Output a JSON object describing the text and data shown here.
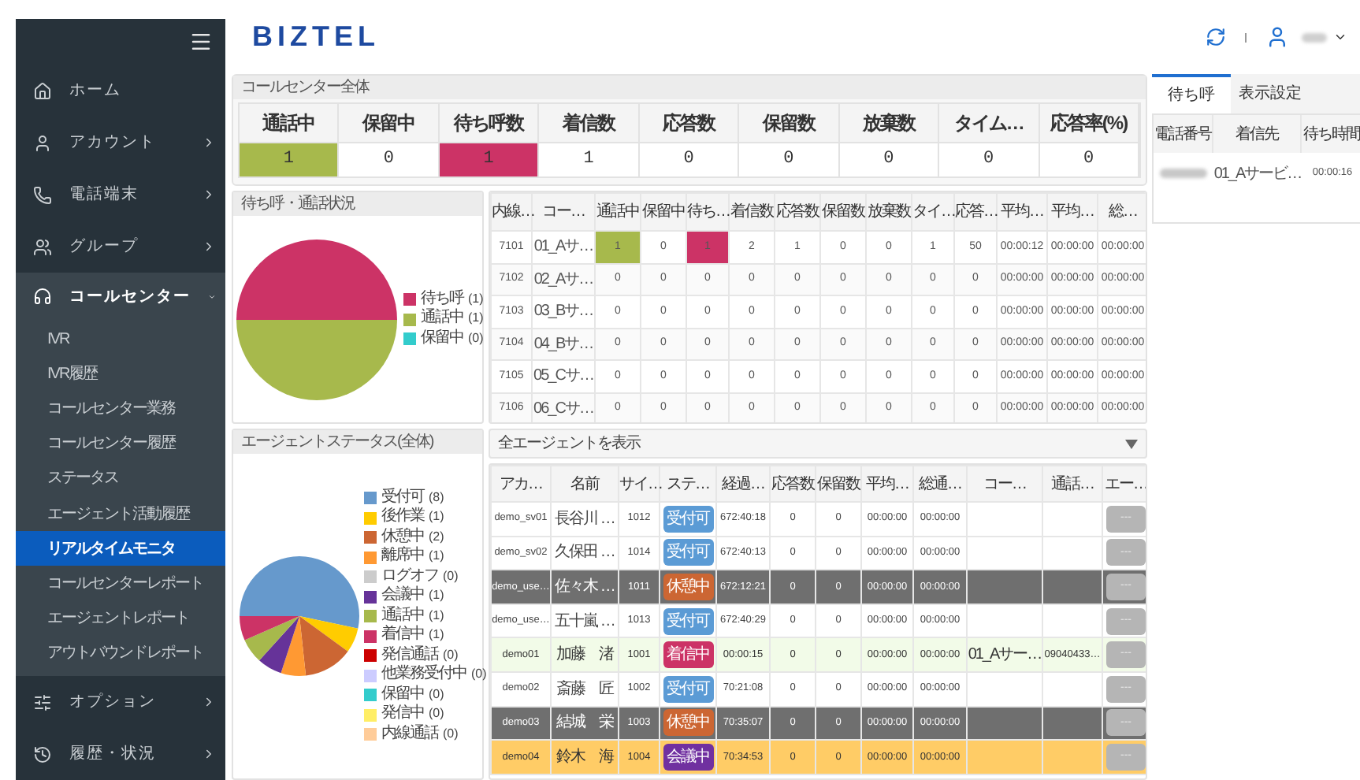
{
  "sidebar": {
    "items": [
      {
        "label": "ホーム",
        "kind": "link"
      },
      {
        "label": "アカウント",
        "kind": "group",
        "expanded": false
      },
      {
        "label": "電話端末",
        "kind": "group",
        "expanded": false
      },
      {
        "label": "グループ",
        "kind": "group",
        "expanded": false
      },
      {
        "label": "コールセンター",
        "kind": "group",
        "expanded": true,
        "children": [
          {
            "label": "IVR",
            "selected": false
          },
          {
            "label": "IVR履歴",
            "selected": false
          },
          {
            "label": "コールセンター業務",
            "selected": false
          },
          {
            "label": "コールセンター履歴",
            "selected": false
          },
          {
            "label": "ステータス",
            "selected": false
          },
          {
            "label": "エージェント活動履歴",
            "selected": false
          },
          {
            "label": "リアルタイムモニタ",
            "selected": true
          },
          {
            "label": "コールセンターレポート",
            "selected": false
          },
          {
            "label": "エージェントレポート",
            "selected": false
          },
          {
            "label": "アウトバウンドレポート",
            "selected": false
          }
        ]
      },
      {
        "label": "オプション",
        "kind": "group",
        "expanded": false
      },
      {
        "label": "履歴・状況",
        "kind": "group",
        "expanded": false
      }
    ]
  },
  "header": {
    "logo": "BIZTEL"
  },
  "summary": {
    "title": "コールセンター全体",
    "columns": [
      {
        "label": "通話中",
        "value": "1",
        "color": "#a7b94c"
      },
      {
        "label": "保留中",
        "value": "0"
      },
      {
        "label": "待ち呼数",
        "value": "1",
        "color": "#cc3366"
      },
      {
        "label": "着信数",
        "value": "1"
      },
      {
        "label": "応答数",
        "value": "0"
      },
      {
        "label": "保留数",
        "value": "0"
      },
      {
        "label": "放棄数",
        "value": "0"
      },
      {
        "label": "タイム…",
        "value": "0"
      },
      {
        "label": "応答率(%)",
        "value": "0"
      }
    ]
  },
  "wait_status": {
    "title": "待ち呼・通話状況",
    "legend": [
      {
        "count": "(1)",
        "color": "#cc3366"
      },
      {
        "count": "(1)",
        "color": "#a7b94c"
      },
      {
        "count": "(0)",
        "color": "#33cccc"
      }
    ],
    "chart_data": {
      "type": "pie",
      "categories": [
        "待ち呼",
        "通話中",
        "保留中"
      ],
      "values": [
        50,
        50,
        0
      ]
    }
  },
  "service_table": {
    "columns": [
      "内線…",
      "コー…",
      "通話中",
      "保留中",
      "待ち…",
      "着信数",
      "応答数",
      "保留数",
      "放棄数",
      "タイ…",
      "応答…",
      "平均…",
      "平均…",
      "総…"
    ],
    "rows": [
      {
        "cells": [
          {
            "text": "7101"
          },
          {
            "text": "01_Aサ…"
          },
          {
            "text": "1",
            "color": "#a7b94c"
          },
          {
            "text": "0"
          },
          {
            "text": "1",
            "color": "#cc3366"
          },
          {
            "text": "2"
          },
          {
            "text": "1"
          },
          {
            "text": "0"
          },
          {
            "text": "0"
          },
          {
            "text": "1"
          },
          {
            "text": "50"
          },
          {
            "text": "00:00:12"
          },
          {
            "text": "00:00:00"
          },
          {
            "text": "00:00:00"
          }
        ]
      },
      {
        "cells": [
          {
            "text": "7102"
          },
          {
            "text": "02_Aサ…"
          },
          {
            "text": "0"
          },
          {
            "text": "0"
          },
          {
            "text": "0"
          },
          {
            "text": "0"
          },
          {
            "text": "0"
          },
          {
            "text": "0"
          },
          {
            "text": "0"
          },
          {
            "text": "0"
          },
          {
            "text": "0"
          },
          {
            "text": "00:00:00"
          },
          {
            "text": "00:00:00"
          },
          {
            "text": "00:00:00"
          }
        ]
      },
      {
        "cells": [
          {
            "text": "7103"
          },
          {
            "text": "03_Bサ…"
          },
          {
            "text": "0"
          },
          {
            "text": "0"
          },
          {
            "text": "0"
          },
          {
            "text": "0"
          },
          {
            "text": "0"
          },
          {
            "text": "0"
          },
          {
            "text": "0"
          },
          {
            "text": "0"
          },
          {
            "text": "0"
          },
          {
            "text": "00:00:00"
          },
          {
            "text": "00:00:00"
          },
          {
            "text": "00:00:00"
          }
        ]
      },
      {
        "cells": [
          {
            "text": "7104"
          },
          {
            "text": "04_Bサ…"
          },
          {
            "text": "0"
          },
          {
            "text": "0"
          },
          {
            "text": "0"
          },
          {
            "text": "0"
          },
          {
            "text": "0"
          },
          {
            "text": "0"
          },
          {
            "text": "0"
          },
          {
            "text": "0"
          },
          {
            "text": "0"
          },
          {
            "text": "00:00:00"
          },
          {
            "text": "00:00:00"
          },
          {
            "text": "00:00:00"
          }
        ]
      },
      {
        "cells": [
          {
            "text": "7105"
          },
          {
            "text": "05_Cサ…"
          },
          {
            "text": "0"
          },
          {
            "text": "0"
          },
          {
            "text": "0"
          },
          {
            "text": "0"
          },
          {
            "text": "0"
          },
          {
            "text": "0"
          },
          {
            "text": "0"
          },
          {
            "text": "0"
          },
          {
            "text": "0"
          },
          {
            "text": "00:00:00"
          },
          {
            "text": "00:00:00"
          },
          {
            "text": "00:00:00"
          }
        ]
      },
      {
        "cells": [
          {
            "text": "7106"
          },
          {
            "text": "06_Cサ…"
          },
          {
            "text": "0"
          },
          {
            "text": "0"
          },
          {
            "text": "0"
          },
          {
            "text": "0"
          },
          {
            "text": "0"
          },
          {
            "text": "0"
          },
          {
            "text": "0"
          },
          {
            "text": "0"
          },
          {
            "text": "0"
          },
          {
            "text": "00:00:00"
          },
          {
            "text": "00:00:00"
          },
          {
            "text": "00:00:00"
          }
        ]
      }
    ]
  },
  "agent_status": {
    "title": "エージェントステータス(全体)",
    "legend": [
      {
        "count": "(8)",
        "color": "#6699cc"
      },
      {
        "count": "(1)",
        "color": "#ffcc00"
      },
      {
        "count": "(2)",
        "color": "#cc6633"
      },
      {
        "count": "(1)",
        "color": "#ff9933"
      },
      {
        "count": "(0)",
        "color": "#cccccc"
      },
      {
        "count": "(1)",
        "color": "#663399"
      },
      {
        "count": "(1)",
        "color": "#a7b94c"
      },
      {
        "count": "(1)",
        "color": "#cc3366"
      },
      {
        "count": "(0)",
        "color": "#cc0000"
      },
      {
        "count": "(0)",
        "color": "#ccccff"
      },
      {
        "count": "(0)",
        "color": "#33cccc"
      },
      {
        "count": "(0)",
        "color": "#ffee66"
      },
      {
        "count": "(0)",
        "color": "#ffcc99"
      }
    ],
    "chart_data": {
      "type": "pie",
      "categories": [
        "受付可",
        "後作業",
        "休憩中",
        "離席中",
        "ログオフ",
        "会議中",
        "通話中",
        "着信中",
        "発信通話",
        "他業務受付中",
        "保留中",
        "発信中",
        "内線通話"
      ],
      "values": [
        53.3,
        6.7,
        13.3,
        6.7,
        0,
        6.7,
        6.7,
        6.6,
        0,
        0,
        0,
        0,
        0
      ]
    }
  },
  "agents": {
    "filter": {
      "value": "全エージェントを表示"
    },
    "columns": [
      "アカ…",
      "名前",
      "サイ…",
      "ステ…",
      "経過…",
      "応答数",
      "保留数",
      "平均…",
      "総通…",
      "コー…",
      "通話…",
      "エー…"
    ],
    "rows": [
      {
        "kind": "normal",
        "account": "demo_sv01",
        "name": "長谷川 …",
        "seat": "1012",
        "status": {
          "label": "受付可",
          "color": "#5b9bd5"
        },
        "elapsed": "672:40:18",
        "answered": "0",
        "held": "0",
        "average": "00:00:00",
        "total": "00:00:00",
        "action": "---"
      },
      {
        "kind": "normal",
        "account": "demo_sv02",
        "name": "久保田 …",
        "seat": "1014",
        "status": {
          "label": "受付可",
          "color": "#5b9bd5"
        },
        "elapsed": "672:40:13",
        "answered": "0",
        "held": "0",
        "average": "00:00:00",
        "total": "00:00:00",
        "action": "---"
      },
      {
        "kind": "break",
        "account": "demo_use…",
        "name": "佐々木 …",
        "seat": "1011",
        "status": {
          "label": "休憩中",
          "color": "#cc6633"
        },
        "elapsed": "672:12:21",
        "answered": "0",
        "held": "0",
        "average": "00:00:00",
        "total": "00:00:00",
        "action": "---"
      },
      {
        "kind": "normal",
        "account": "demo_use…",
        "name": "五十嵐 …",
        "seat": "1013",
        "status": {
          "label": "受付可",
          "color": "#5b9bd5"
        },
        "elapsed": "672:40:29",
        "answered": "0",
        "held": "0",
        "average": "00:00:00",
        "total": "00:00:00",
        "action": "---"
      },
      {
        "kind": "ringing",
        "account": "demo01",
        "name": "加藤　渚",
        "seat": "1001",
        "status": {
          "label": "着信中",
          "color": "#cc3366"
        },
        "elapsed": "00:00:15",
        "answered": "0",
        "held": "0",
        "average": "00:00:00",
        "total": "00:00:00",
        "column_10": "01_Aサー…",
        "column_11": "09040433…",
        "action": "---"
      },
      {
        "kind": "normal",
        "account": "demo02",
        "name": "斎藤　匠",
        "seat": "1002",
        "status": {
          "label": "受付可",
          "color": "#5b9bd5"
        },
        "elapsed": "70:21:08",
        "answered": "0",
        "held": "0",
        "average": "00:00:00",
        "total": "00:00:00",
        "action": "---"
      },
      {
        "kind": "break",
        "account": "demo03",
        "name": "結城　栄",
        "seat": "1003",
        "status": {
          "label": "休憩中",
          "color": "#cc6633"
        },
        "elapsed": "70:35:07",
        "answered": "0",
        "held": "0",
        "average": "00:00:00",
        "total": "00:00:00",
        "action": "---"
      },
      {
        "kind": "meeting",
        "account": "demo04",
        "name": "鈴木　海",
        "seat": "1004",
        "status": {
          "label": "会議中",
          "color": "#7030a0"
        },
        "elapsed": "70:34:53",
        "answered": "0",
        "held": "0",
        "average": "00:00:00",
        "total": "00:00:00",
        "action": "---"
      }
    ]
  },
  "queue_panel": {
    "tabs": [
      {
        "label": "待ち呼",
        "selected": true
      },
      {
        "label": "表示設定",
        "selected": false
      }
    ],
    "columns": [
      "電話番号",
      "着信先",
      "待ち時間"
    ],
    "rows": [
      {
        "destination": "01_Aサービ…",
        "wait": "00:00:16"
      }
    ]
  }
}
